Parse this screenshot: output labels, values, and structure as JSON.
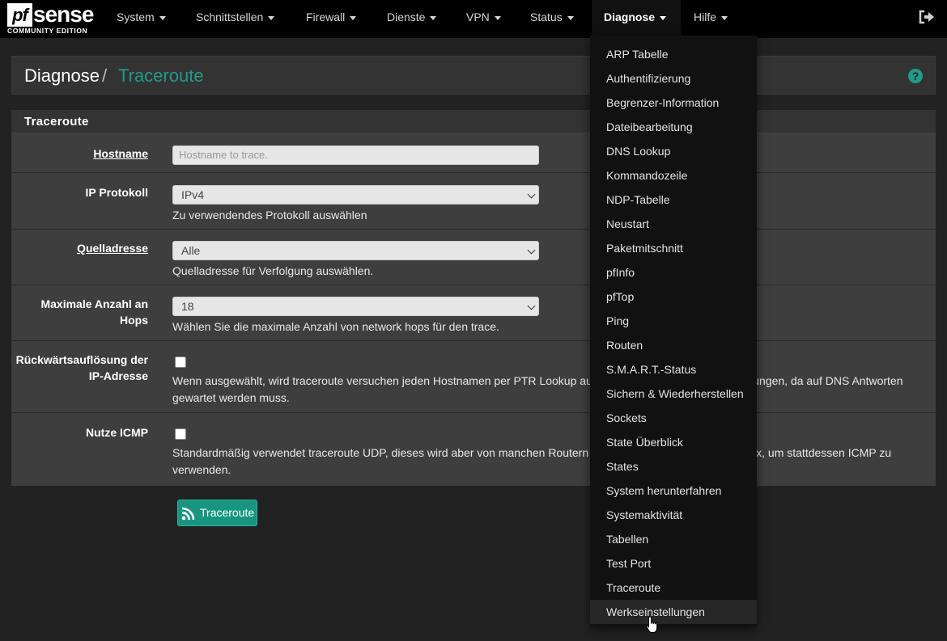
{
  "brand": {
    "logo_pf": "pf",
    "logo_sense": "sense",
    "edition": "COMMUNITY EDITION"
  },
  "nav": {
    "items": [
      {
        "label": "System"
      },
      {
        "label": "Schnittstellen"
      },
      {
        "label": "Firewall"
      },
      {
        "label": "Dienste"
      },
      {
        "label": "VPN"
      },
      {
        "label": "Status"
      },
      {
        "label": "Diagnose",
        "active": true
      },
      {
        "label": "Hilfe"
      }
    ],
    "logout_icon": "logout-icon"
  },
  "breadcrumb": {
    "parent": "Diagnose",
    "separator": "/",
    "current": "Traceroute",
    "help_icon": "question-circle-icon"
  },
  "panel": {
    "title": "Traceroute"
  },
  "form": {
    "hostname": {
      "label": "Hostname",
      "placeholder": "Hostname to trace.",
      "value": ""
    },
    "ip_protocol": {
      "label": "IP Protokoll",
      "value": "IPv4",
      "help": "Zu verwendendes Protokoll auswählen"
    },
    "source": {
      "label": "Quelladresse",
      "value": "Alle",
      "help": "Quelladresse für Verfolgung auswählen."
    },
    "max_hops": {
      "label_line1": "Maximale Anzahl an",
      "label_line2": "Hops",
      "value": "18",
      "help": "Wählen Sie die maximale Anzahl von network hops für den trace."
    },
    "reverse": {
      "label_line1": "Rückwärtsauflösung der",
      "label_line2": "IP-Adresse",
      "checked": false,
      "help_line1": "Wenn ausgewählt, wird traceroute versuchen jeden Hostnamen per PTR Lookup aufzulösen. Dies führt zu Verzögerungen, da auf DNS Antworten",
      "help_line2": "gewartet werden muss."
    },
    "icmp": {
      "label": "Nutze ICMP",
      "checked": false,
      "help_line1": "Standardmäßig verwendet traceroute UDP, dieses wird aber von manchen Routern geblockt. Aktivieren Sie diese Box, um stattdessen ICMP zu",
      "help_line2": "verwenden."
    },
    "submit": {
      "label": "Traceroute",
      "icon": "rss-icon"
    }
  },
  "diagnose_menu": {
    "items": [
      "ARP Tabelle",
      "Authentifizierung",
      "Begrenzer-Information",
      "Dateibearbeitung",
      "DNS Lookup",
      "Kommandozeile",
      "NDP-Tabelle",
      "Neustart",
      "Paketmitschnitt",
      "pfInfo",
      "pfTop",
      "Ping",
      "Routen",
      "S.M.A.R.T.-Status",
      "Sichern & Wiederherstellen",
      "Sockets",
      "State Überblick",
      "States",
      "System herunterfahren",
      "Systemaktivität",
      "Tabellen",
      "Test Port",
      "Traceroute",
      "Werkseinstellungen"
    ],
    "hovered": "Werkseinstellungen"
  },
  "colors": {
    "accent": "#1e9c8b",
    "navbar": "#000000",
    "background": "#222222"
  }
}
